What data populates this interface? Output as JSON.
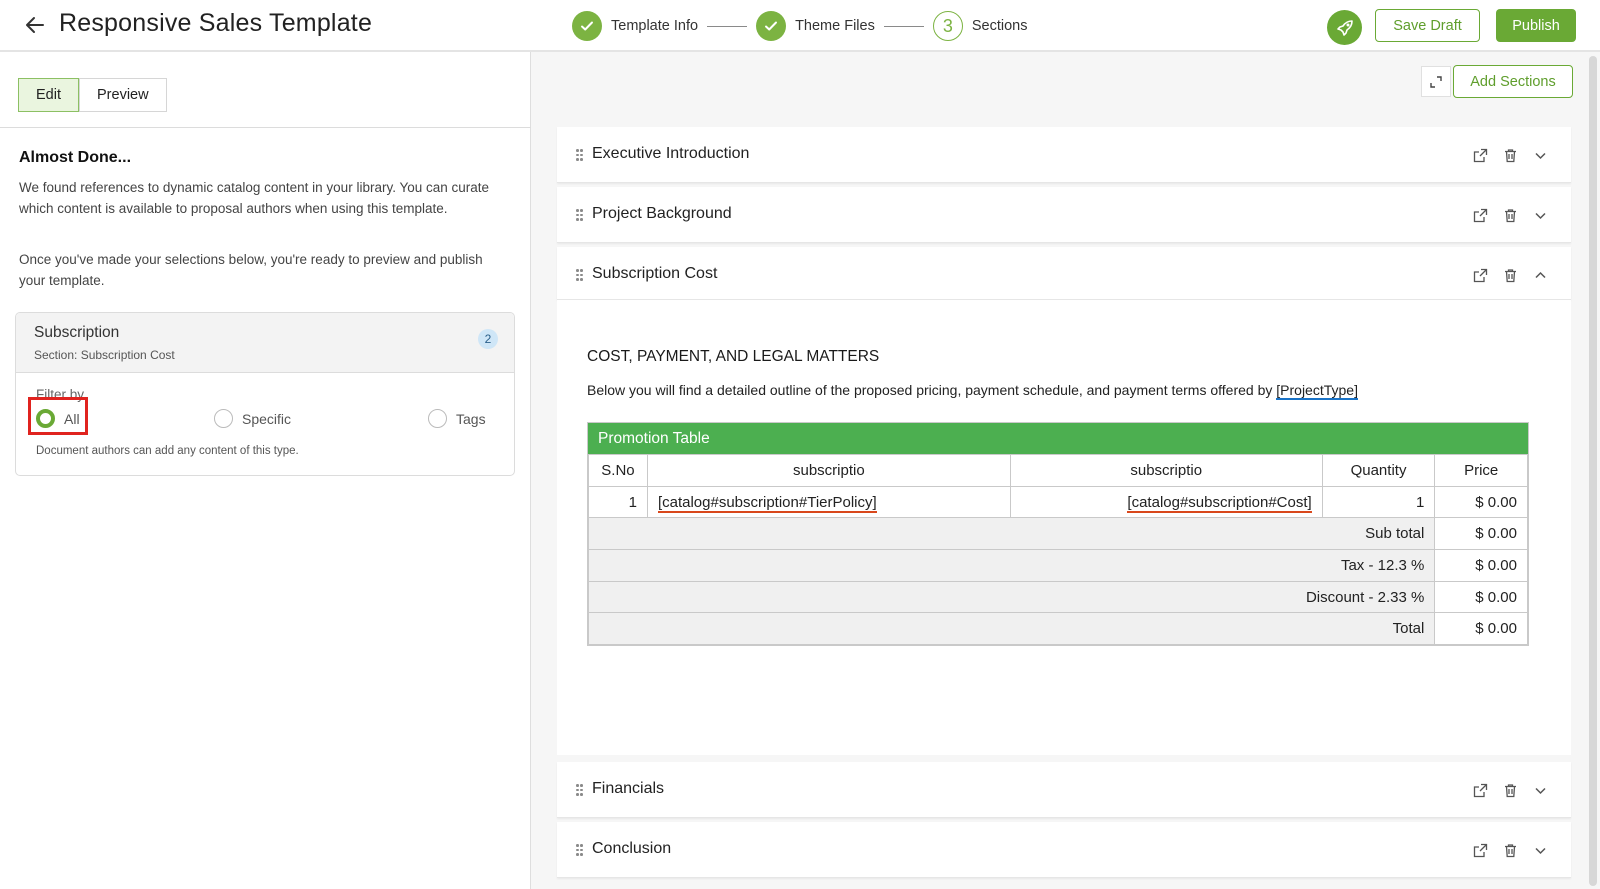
{
  "header": {
    "title": "Responsive Sales Template",
    "steps": [
      {
        "label": "Template Info",
        "state": "done"
      },
      {
        "label": "Theme Files",
        "state": "done"
      },
      {
        "label": "Sections",
        "state": "current",
        "number": "3"
      }
    ],
    "save_draft_label": "Save Draft",
    "publish_label": "Publish"
  },
  "left": {
    "tabs": [
      {
        "label": "Edit",
        "active": true
      },
      {
        "label": "Preview",
        "active": false
      }
    ],
    "heading": "Almost Done...",
    "paragraph1": "We found references to dynamic catalog content in your library. You can curate which content is available to proposal authors when using this template.",
    "paragraph2": "Once you've made your selections below, you're ready to preview and publish your template.",
    "card": {
      "title": "Subscription",
      "section": "Section: Subscription Cost",
      "badge": "2",
      "filter_label": "Filter by",
      "options": [
        {
          "label": "All",
          "checked": true
        },
        {
          "label": "Specific",
          "checked": false
        },
        {
          "label": "Tags",
          "checked": false
        }
      ],
      "help_text": "Document authors can add any content of this type."
    }
  },
  "right": {
    "add_sections_label": "Add Sections",
    "sections": [
      {
        "title": "Executive Introduction",
        "expanded": false
      },
      {
        "title": "Project Background",
        "expanded": false
      },
      {
        "title": "Subscription Cost",
        "expanded": true
      },
      {
        "title": "Financials",
        "expanded": false
      },
      {
        "title": "Conclusion",
        "expanded": false
      }
    ],
    "cost_body": {
      "heading": "COST, PAYMENT, AND LEGAL MATTERS",
      "description": "Below you will find a detailed outline of the proposed pricing, payment schedule, and payment terms offered by",
      "placeholder": "[ProjectType]",
      "table": {
        "title": "Promotion Table",
        "columns": [
          "S.No",
          "subscriptio",
          "subscriptio",
          "Quantity",
          "Price"
        ],
        "row": {
          "sno": "1",
          "col1": "[catalog#subscription#TierPolicy]",
          "col2": "[catalog#subscription#Cost]",
          "quantity": "1",
          "price": "$ 0.00"
        },
        "summary": [
          {
            "label": "Sub total",
            "value": "$ 0.00"
          },
          {
            "label": "Tax - 12.3 %",
            "value": "$ 0.00"
          },
          {
            "label": "Discount - 2.33 %",
            "value": "$ 0.00"
          },
          {
            "label": "Total",
            "value": "$ 0.00"
          }
        ]
      }
    }
  },
  "colors": {
    "accent": "#6aa935",
    "table_header": "#4caf50",
    "highlight": "#e0231f"
  }
}
